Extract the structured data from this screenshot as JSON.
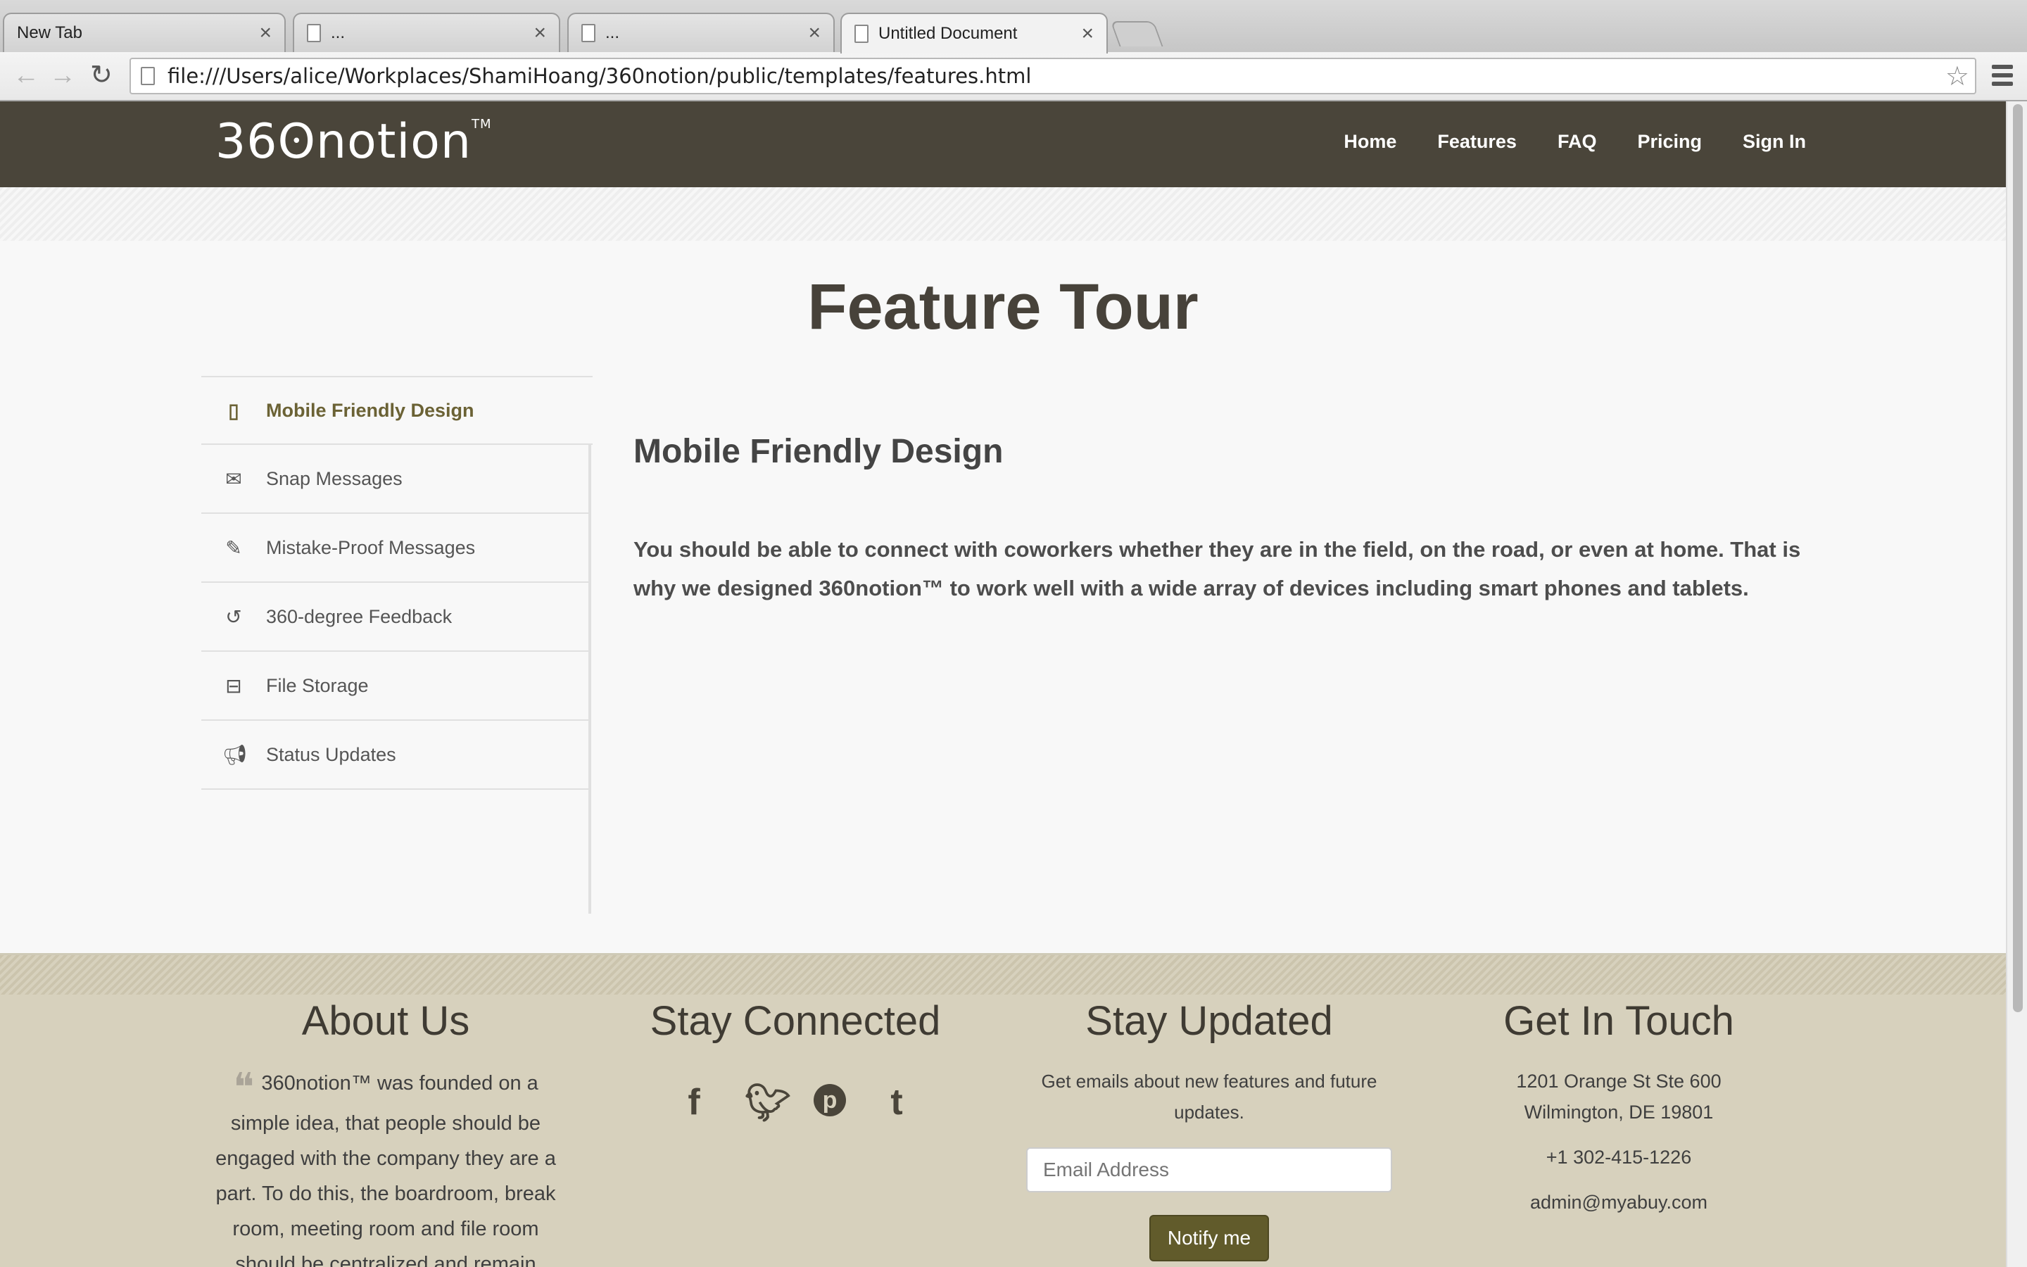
{
  "browser": {
    "tabs": [
      {
        "label": "New Tab"
      },
      {
        "label": "..."
      },
      {
        "label": "..."
      },
      {
        "label": "Untitled Document"
      }
    ],
    "url": "file:///Users/alice/Workplaces/ShamiHoang/360notion/public/templates/features.html"
  },
  "site": {
    "logo": "36ʘnotion",
    "logo_tm": "TM",
    "nav": [
      "Home",
      "Features",
      "FAQ",
      "Pricing",
      "Sign In"
    ]
  },
  "main": {
    "title": "Feature Tour",
    "sidebar": [
      {
        "label": "Mobile Friendly Design",
        "icon": "mobile-icon"
      },
      {
        "label": "Snap Messages",
        "icon": "envelope-icon"
      },
      {
        "label": "Mistake-Proof Messages",
        "icon": "edit-icon"
      },
      {
        "label": "360-degree Feedback",
        "icon": "undo-icon"
      },
      {
        "label": "File Storage",
        "icon": "inbox-icon"
      },
      {
        "label": "Status Updates",
        "icon": "bullhorn-icon"
      }
    ],
    "content": {
      "title": "Mobile Friendly Design",
      "body": "You should be able to connect with coworkers whether they are in the field, on the road, or even at home. That is why we designed 360notion™ to work well with a wide array of devices including smart phones and tablets."
    }
  },
  "footer": {
    "about": {
      "title": "About Us",
      "text": "360notion™ was founded on a simple idea, that people should be engaged with the company they are a part. To do this, the boardroom, break room, meeting room and file room should be centralized and remain"
    },
    "connected": {
      "title": "Stay Connected",
      "socials": [
        "facebook-icon",
        "twitter-icon",
        "pinterest-icon",
        "tumblr-icon"
      ]
    },
    "updated": {
      "title": "Stay Updated",
      "text": "Get emails about new features and future updates.",
      "email_placeholder": "Email Address",
      "button": "Notify me"
    },
    "touch": {
      "title": "Get In Touch",
      "address_line1": "1201 Orange St Ste 600",
      "address_line2": "Wilmington, DE 19801",
      "phone": "+1 302-415-1226",
      "email": "admin@myabuy.com"
    }
  }
}
